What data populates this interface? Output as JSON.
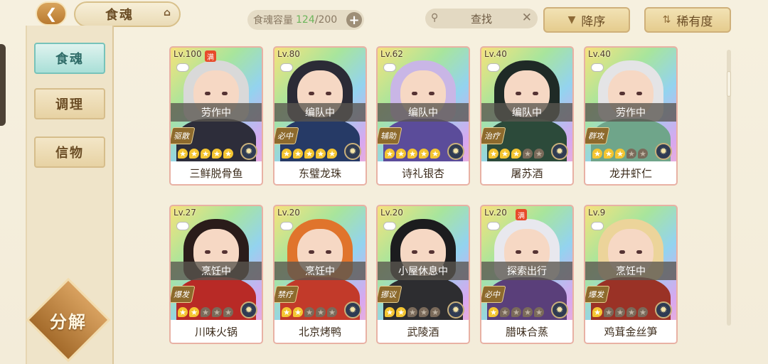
{
  "header": {
    "back_icon": "back-arrow-icon",
    "title": "食魂",
    "home_icon": "home-icon",
    "capacity_label": "食魂容量",
    "capacity_current": "124",
    "capacity_total": "/200",
    "capacity_add": "+",
    "search_placeholder": "查找",
    "sort_desc_label": "降序",
    "sort_rarity_label": "稀有度"
  },
  "sidebar": {
    "tabs": [
      "食魂",
      "调理",
      "信物"
    ],
    "active": 0,
    "decompose_label": "分解"
  },
  "cards": [
    {
      "level": "Lv.100",
      "badge": "满",
      "status": "劳作中",
      "role": "驱散",
      "stars": 5,
      "name": "三鲜脱骨鱼",
      "hair": "#d9d9d9",
      "body": "#2d2d3a"
    },
    {
      "level": "Lv.80",
      "badge": "",
      "status": "编队中",
      "role": "必中",
      "stars": 5,
      "name": "东璧龙珠",
      "hair": "#2b2b36",
      "body": "#263a66"
    },
    {
      "level": "Lv.62",
      "badge": "",
      "status": "编队中",
      "role": "辅助",
      "stars": 5,
      "name": "诗礼银杏",
      "hair": "#c9b6e6",
      "body": "#5b4c9a"
    },
    {
      "level": "Lv.40",
      "badge": "",
      "status": "编队中",
      "role": "治疗",
      "stars": 3,
      "name": "屠苏酒",
      "hair": "#1f2a26",
      "body": "#2c4a3a"
    },
    {
      "level": "Lv.40",
      "badge": "",
      "status": "劳作中",
      "role": "群攻",
      "stars": 3,
      "name": "龙井虾仁",
      "hair": "#e4e4e6",
      "body": "#6fa58a"
    },
    {
      "level": "Lv.27",
      "badge": "",
      "status": "烹饪中",
      "role": "爆发",
      "stars": 2,
      "name": "川味火锅",
      "hair": "#2a1c1a",
      "body": "#b82a26"
    },
    {
      "level": "Lv.20",
      "badge": "",
      "status": "烹饪中",
      "role": "禁疗",
      "stars": 2,
      "name": "北京烤鸭",
      "hair": "#e0742c",
      "body": "#c23a2a"
    },
    {
      "level": "Lv.20",
      "badge": "",
      "status": "小屋休息中",
      "role": "挪议",
      "stars": 2,
      "name": "武陵酒",
      "hair": "#1c1c1e",
      "body": "#2d2d30"
    },
    {
      "level": "Lv.20",
      "badge": "满",
      "status": "探索出行",
      "role": "必中",
      "stars": 1,
      "name": "腊味合蒸",
      "hair": "#e8e8ee",
      "body": "#5a3f7a"
    },
    {
      "level": "Lv.9",
      "badge": "",
      "status": "烹饪中",
      "role": "爆发",
      "stars": 1,
      "name": "鸡茸金丝笋",
      "hair": "#ecd49a",
      "body": "#9a3226"
    }
  ]
}
